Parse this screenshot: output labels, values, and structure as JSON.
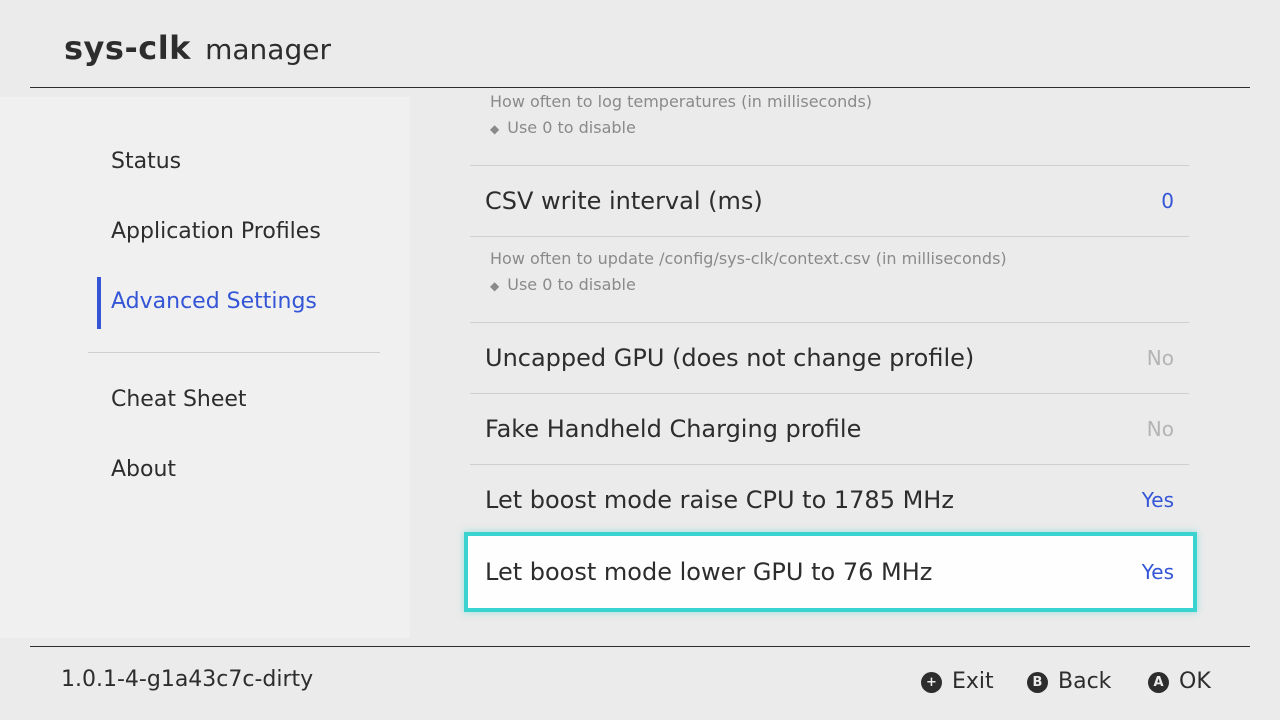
{
  "header": {
    "title_bold": "sys-clk",
    "title_light": "manager"
  },
  "sidebar": {
    "items": [
      {
        "label": "Status"
      },
      {
        "label": "Application Profiles"
      },
      {
        "label": "Advanced Settings",
        "active": true
      },
      {
        "label": "Cheat Sheet"
      },
      {
        "label": "About"
      }
    ]
  },
  "content": {
    "top_info": {
      "line1": "How often to log temperatures (in milliseconds)",
      "bullet": "Use 0 to disable"
    },
    "csv_row": {
      "label": "CSV write interval (ms)",
      "value": "0"
    },
    "csv_info": {
      "line1": "How often to update /config/sys-clk/context.csv (in milliseconds)",
      "bullet": "Use 0 to disable"
    },
    "rows": [
      {
        "label": "Uncapped GPU (does not change profile)",
        "value": "No"
      },
      {
        "label": "Fake Handheld Charging profile",
        "value": "No"
      },
      {
        "label": "Let boost mode raise CPU to 1785 MHz",
        "value": "Yes"
      },
      {
        "label": "Let boost mode lower GPU to 76 MHz",
        "value": "Yes",
        "selected": true
      }
    ]
  },
  "footer": {
    "version": "1.0.1-4-g1a43c7c-dirty",
    "hints": [
      {
        "glyph": "+",
        "label": "Exit"
      },
      {
        "glyph": "B",
        "label": "Back"
      },
      {
        "glyph": "A",
        "label": "OK"
      }
    ]
  },
  "colors": {
    "background": "#ebebeb",
    "accent": "#3355d6",
    "selection_border": "#3ad3d0",
    "muted": "#b4b4b4"
  }
}
